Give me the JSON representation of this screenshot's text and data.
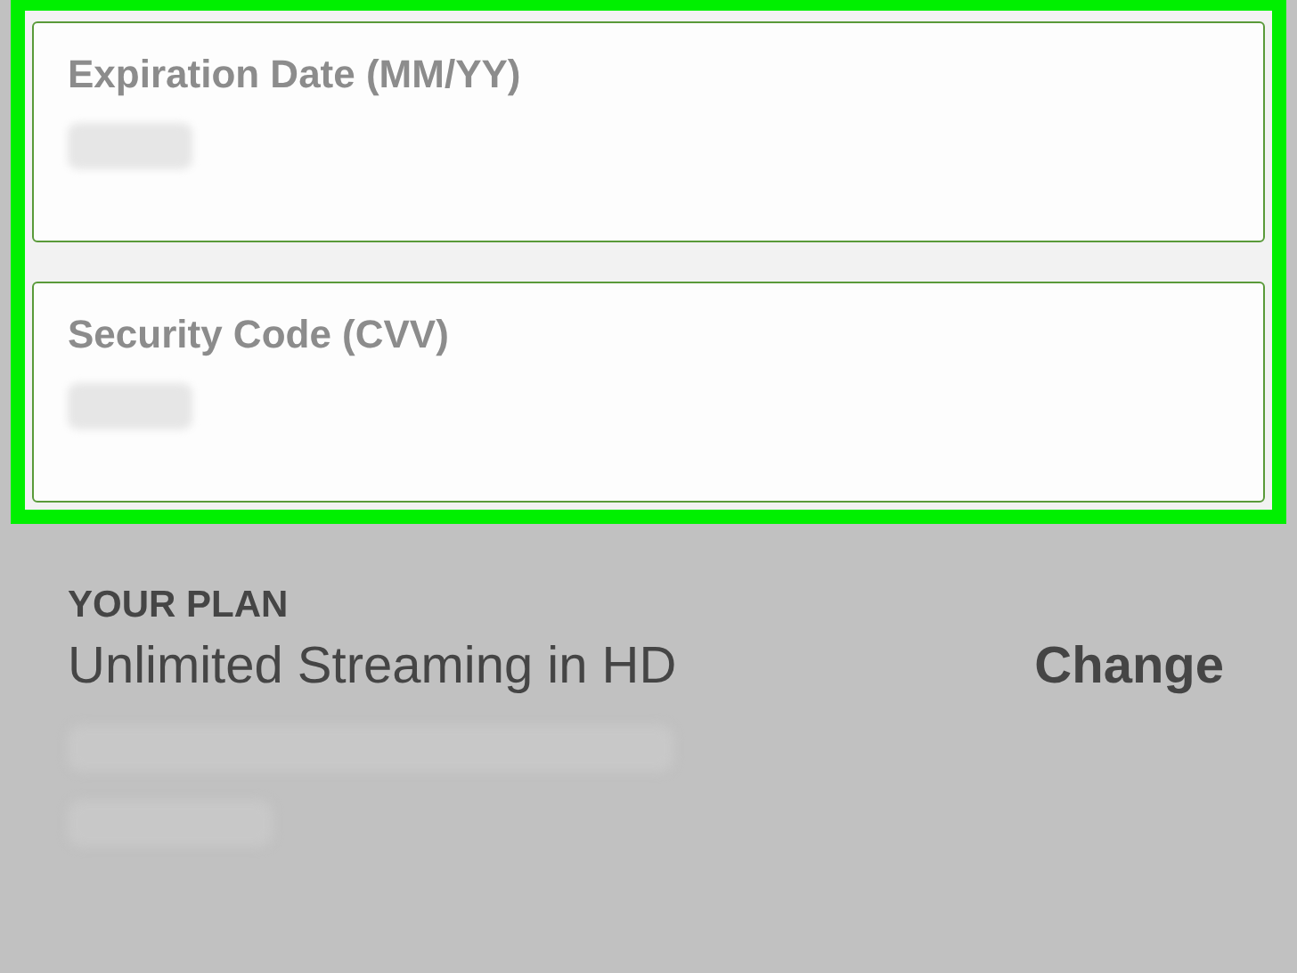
{
  "payment_fields": [
    {
      "label": "Expiration Date (MM/YY)"
    },
    {
      "label": "Security Code (CVV)"
    }
  ],
  "plan": {
    "heading": "YOUR PLAN",
    "name": "Unlimited Streaming in HD",
    "action": "Change"
  }
}
